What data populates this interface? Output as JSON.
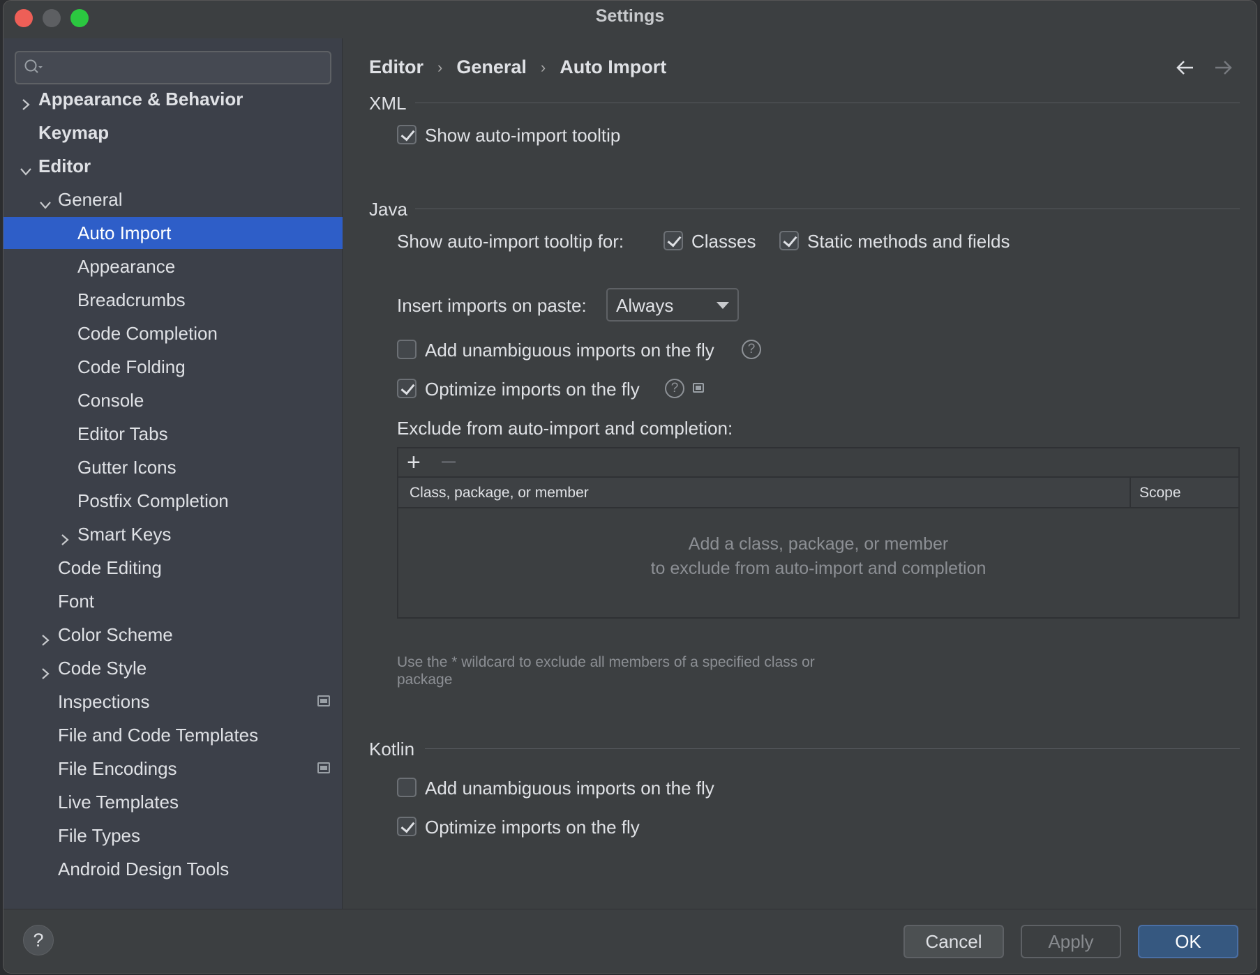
{
  "window": {
    "title": "Settings"
  },
  "sidebar": {
    "search_placeholder": "",
    "items": [
      {
        "label": "Appearance & Behavior",
        "bold": true,
        "chevron": "right"
      },
      {
        "label": "Keymap",
        "bold": true
      },
      {
        "label": "Editor",
        "bold": true,
        "chevron": "down"
      },
      {
        "label": "General",
        "chevron": "down"
      },
      {
        "label": "Auto Import",
        "selected": true
      },
      {
        "label": "Appearance"
      },
      {
        "label": "Breadcrumbs"
      },
      {
        "label": "Code Completion"
      },
      {
        "label": "Code Folding"
      },
      {
        "label": "Console"
      },
      {
        "label": "Editor Tabs"
      },
      {
        "label": "Gutter Icons"
      },
      {
        "label": "Postfix Completion"
      },
      {
        "label": "Smart Keys",
        "chevron": "right"
      },
      {
        "label": "Code Editing"
      },
      {
        "label": "Font"
      },
      {
        "label": "Color Scheme",
        "chevron": "right"
      },
      {
        "label": "Code Style",
        "chevron": "right"
      },
      {
        "label": "Inspections",
        "icon": "project-settings-icon"
      },
      {
        "label": "File and Code Templates"
      },
      {
        "label": "File Encodings",
        "icon": "project-settings-icon"
      },
      {
        "label": "Live Templates"
      },
      {
        "label": "File Types"
      },
      {
        "label": "Android Design Tools"
      }
    ]
  },
  "breadcrumb": [
    "Editor",
    "General",
    "Auto Import"
  ],
  "xml": {
    "title": "XML",
    "show_tooltip": {
      "label": "Show auto-import tooltip",
      "checked": true
    }
  },
  "java": {
    "title": "Java",
    "tooltip_for_label": "Show auto-import tooltip for:",
    "classes": {
      "label": "Classes",
      "checked": true
    },
    "static": {
      "label": "Static methods and fields",
      "checked": true
    },
    "insert_label": "Insert imports on paste:",
    "insert_value": "Always",
    "add_unambiguous": {
      "label": "Add unambiguous imports on the fly",
      "checked": false
    },
    "optimize": {
      "label": "Optimize imports on the fly",
      "checked": true
    },
    "exclude_label": "Exclude from auto-import and completion:",
    "table": {
      "col1": "Class, package, or member",
      "col2": "Scope",
      "empty_line1": "Add a class, package, or member",
      "empty_line2": "to exclude from auto-import and completion"
    },
    "hint": "Use the * wildcard to exclude all members of a specified class or package"
  },
  "kotlin": {
    "title": "Kotlin",
    "add_unambiguous": {
      "label": "Add unambiguous imports on the fly",
      "checked": false
    },
    "optimize": {
      "label": "Optimize imports on the fly",
      "checked": true
    }
  },
  "footer": {
    "cancel": "Cancel",
    "apply": "Apply",
    "ok": "OK",
    "help": "?"
  }
}
